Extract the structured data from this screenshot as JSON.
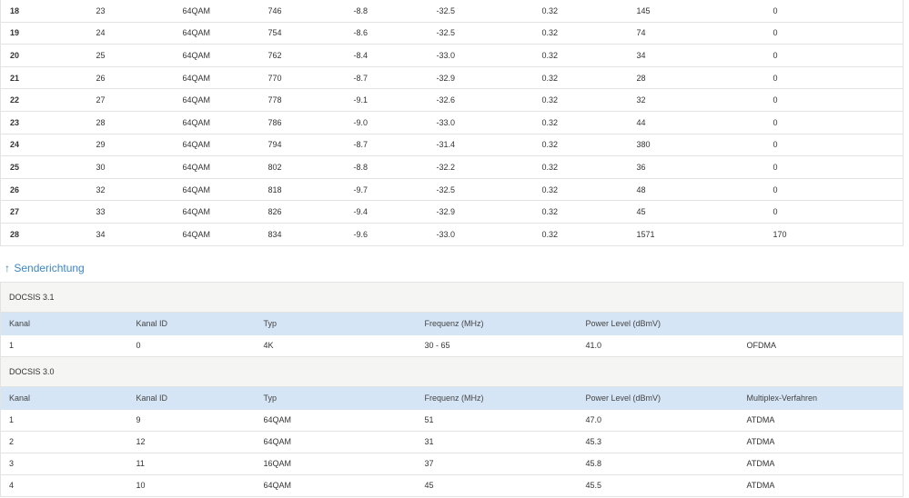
{
  "downstream_rows": [
    [
      "18",
      "23",
      "64QAM",
      "746",
      "-8.8",
      "-32.5",
      "0.32",
      "145",
      "0"
    ],
    [
      "19",
      "24",
      "64QAM",
      "754",
      "-8.6",
      "-32.5",
      "0.32",
      "74",
      "0"
    ],
    [
      "20",
      "25",
      "64QAM",
      "762",
      "-8.4",
      "-33.0",
      "0.32",
      "34",
      "0"
    ],
    [
      "21",
      "26",
      "64QAM",
      "770",
      "-8.7",
      "-32.9",
      "0.32",
      "28",
      "0"
    ],
    [
      "22",
      "27",
      "64QAM",
      "778",
      "-9.1",
      "-32.6",
      "0.32",
      "32",
      "0"
    ],
    [
      "23",
      "28",
      "64QAM",
      "786",
      "-9.0",
      "-33.0",
      "0.32",
      "44",
      "0"
    ],
    [
      "24",
      "29",
      "64QAM",
      "794",
      "-8.7",
      "-31.4",
      "0.32",
      "380",
      "0"
    ],
    [
      "25",
      "30",
      "64QAM",
      "802",
      "-8.8",
      "-32.2",
      "0.32",
      "36",
      "0"
    ],
    [
      "26",
      "32",
      "64QAM",
      "818",
      "-9.7",
      "-32.5",
      "0.32",
      "48",
      "0"
    ],
    [
      "27",
      "33",
      "64QAM",
      "826",
      "-9.4",
      "-32.9",
      "0.32",
      "45",
      "0"
    ],
    [
      "28",
      "34",
      "64QAM",
      "834",
      "-9.6",
      "-33.0",
      "0.32",
      "1571",
      "170"
    ]
  ],
  "upstream_link": {
    "arrow": "↑",
    "label": "Senderichtung"
  },
  "docsis31": {
    "title": "DOCSIS 3.1",
    "headers": [
      "Kanal",
      "Kanal ID",
      "Typ",
      "Frequenz (MHz)",
      "Power Level (dBmV)",
      ""
    ],
    "rows": [
      [
        "1",
        "0",
        "4K",
        "30 - 65",
        "41.0",
        "OFDMA"
      ]
    ]
  },
  "docsis30": {
    "title": "DOCSIS 3.0",
    "headers": [
      "Kanal",
      "Kanal ID",
      "Typ",
      "Frequenz (MHz)",
      "Power Level (dBmV)",
      "Multiplex-Verfahren"
    ],
    "rows": [
      [
        "1",
        "9",
        "64QAM",
        "51",
        "47.0",
        "ATDMA"
      ],
      [
        "2",
        "12",
        "64QAM",
        "31",
        "45.3",
        "ATDMA"
      ],
      [
        "3",
        "11",
        "16QAM",
        "37",
        "45.8",
        "ATDMA"
      ],
      [
        "4",
        "10",
        "64QAM",
        "45",
        "45.5",
        "ATDMA"
      ]
    ]
  }
}
